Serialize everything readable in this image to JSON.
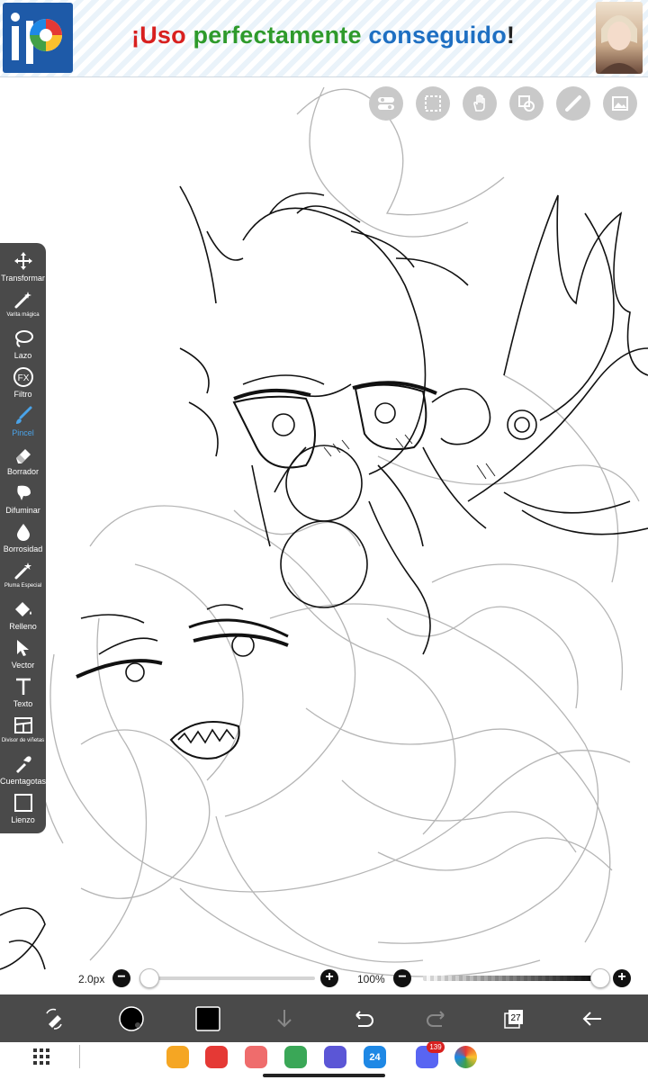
{
  "ad": {
    "text_parts": [
      "¡Uso ",
      "perfectamente ",
      "conseguido",
      "!"
    ],
    "logo_icon": "ibispaint-logo-icon"
  },
  "quick_tools": [
    {
      "name": "layers-toggle-icon"
    },
    {
      "name": "selection-icon"
    },
    {
      "name": "hand-icon"
    },
    {
      "name": "copy-paste-icon"
    },
    {
      "name": "ruler-icon"
    },
    {
      "name": "reference-image-icon"
    }
  ],
  "toolbar": {
    "tools": [
      {
        "label": "Transformar",
        "icon": "move-icon"
      },
      {
        "label": "Varita mágica",
        "icon": "magic-wand-icon"
      },
      {
        "label": "Lazo",
        "icon": "lasso-icon"
      },
      {
        "label": "Filtro",
        "icon": "fx-icon"
      },
      {
        "label": "Pincel",
        "icon": "brush-icon",
        "active": true
      },
      {
        "label": "Borrador",
        "icon": "eraser-icon"
      },
      {
        "label": "Difuminar",
        "icon": "blur-icon"
      },
      {
        "label": "Borrosidad",
        "icon": "drop-icon"
      },
      {
        "label": "Pluma Especial",
        "icon": "special-pen-icon"
      },
      {
        "label": "Relleno",
        "icon": "fill-icon"
      },
      {
        "label": "Vector",
        "icon": "vector-cursor-icon"
      },
      {
        "label": "Texto",
        "icon": "text-icon"
      },
      {
        "label": "Divisor de viñetas",
        "icon": "frame-divider-icon"
      },
      {
        "label": "Cuentagotas",
        "icon": "eyedropper-icon"
      },
      {
        "label": "Lienzo",
        "icon": "canvas-icon"
      }
    ]
  },
  "sliders": {
    "brush_size": "2.0px",
    "brush_size_fraction": 0.0,
    "opacity": "100%",
    "opacity_fraction": 1.0,
    "minus": "−",
    "plus": "+"
  },
  "bottom_bar": {
    "layer_count": "27",
    "items": [
      "tool-swap-icon",
      "color-picker-icon",
      "secondary-color-icon",
      "download-icon",
      "undo-icon",
      "redo-icon",
      "layers-icon",
      "back-icon"
    ]
  },
  "system_nav": {
    "calendar_day": "24",
    "discord_badge": "139"
  },
  "colors": {
    "toolbar_bg": "#4a4a4a",
    "active_tool": "#4aa3e8",
    "accent_red": "#d8201f"
  }
}
